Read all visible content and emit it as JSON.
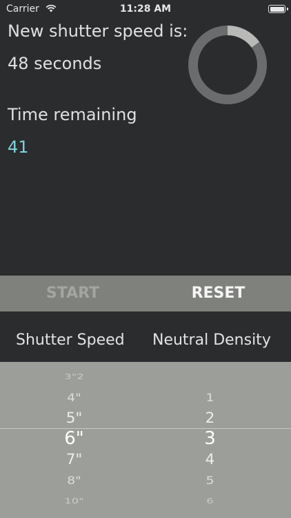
{
  "status": {
    "carrier": "Carrier",
    "time": "11:28 AM"
  },
  "main": {
    "new_speed_label": "New shutter speed is:",
    "new_speed_value": "48 seconds",
    "remaining_label": "Time remaining",
    "remaining_value": "41",
    "progress_fraction": 0.15
  },
  "buttons": {
    "start": "START",
    "reset": "RESET"
  },
  "headers": {
    "shutter_speed": "Shutter Speed",
    "neutral_density": "Neutral Density"
  },
  "picker": {
    "shutter_speed_items": [
      "3\"2",
      "4\"",
      "5\"",
      "6\"",
      "7\"",
      "8\"",
      "10\""
    ],
    "neutral_density_items": [
      "1",
      "2",
      "3",
      "4",
      "5",
      "6"
    ],
    "selected_shutter_speed": "6\"",
    "selected_neutral_density": "3"
  },
  "colors": {
    "background": "#2b2c2e",
    "accent_remaining": "#7fd3e0",
    "button_bar": "#7f817d",
    "picker_bg": "#9c9e9a"
  }
}
